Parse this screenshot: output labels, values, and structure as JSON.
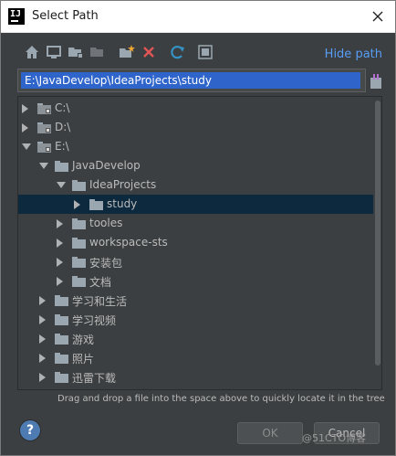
{
  "window": {
    "title": "Select Path",
    "app_icon_text": "IJ"
  },
  "toolbar": {
    "buttons": [
      {
        "icon": "home-icon"
      },
      {
        "icon": "desktop-icon"
      },
      {
        "icon": "project-folder-icon"
      },
      {
        "icon": "module-folder-icon"
      },
      {
        "icon": "new-folder-icon"
      },
      {
        "icon": "delete-icon",
        "color": "#e05555"
      },
      {
        "icon": "refresh-icon",
        "color": "#3592c4"
      },
      {
        "icon": "show-hidden-icon"
      }
    ],
    "hide_path_label": "Hide path"
  },
  "path": {
    "value": "E:\\JavaDevelop\\IdeaProjects\\study"
  },
  "tree": {
    "rows": [
      {
        "label": "C:\\",
        "expanded": false,
        "depth": 0,
        "kind": "drive"
      },
      {
        "label": "D:\\",
        "expanded": false,
        "depth": 0,
        "kind": "drive"
      },
      {
        "label": "E:\\",
        "expanded": true,
        "depth": 0,
        "kind": "drive"
      },
      {
        "label": "JavaDevelop",
        "expanded": true,
        "depth": 1,
        "kind": "folder"
      },
      {
        "label": "IdeaProjects",
        "expanded": true,
        "depth": 2,
        "kind": "folder"
      },
      {
        "label": "study",
        "expanded": false,
        "depth": 3,
        "kind": "folder",
        "selected": true
      },
      {
        "label": "tooles",
        "expanded": false,
        "depth": 2,
        "kind": "folder"
      },
      {
        "label": "workspace-sts",
        "expanded": false,
        "depth": 2,
        "kind": "folder"
      },
      {
        "label": "安装包",
        "expanded": false,
        "depth": 2,
        "kind": "folder"
      },
      {
        "label": "文档",
        "expanded": false,
        "depth": 2,
        "kind": "folder"
      },
      {
        "label": "学习和生活",
        "expanded": false,
        "depth": 1,
        "kind": "folder"
      },
      {
        "label": "学习视频",
        "expanded": false,
        "depth": 1,
        "kind": "folder"
      },
      {
        "label": "游戏",
        "expanded": false,
        "depth": 1,
        "kind": "folder"
      },
      {
        "label": "照片",
        "expanded": false,
        "depth": 1,
        "kind": "folder"
      },
      {
        "label": "迅雷下载",
        "expanded": false,
        "depth": 1,
        "kind": "folder"
      }
    ]
  },
  "hint": "Drag and drop a file into the space above to quickly locate it in the tree",
  "buttons": {
    "help": "?",
    "ok": "OK",
    "cancel": "Cancel"
  },
  "watermark": "@51CTO博客",
  "colors": {
    "accent": "#589df6",
    "selection": "#0d293e",
    "path_highlight": "#2f65ca"
  }
}
